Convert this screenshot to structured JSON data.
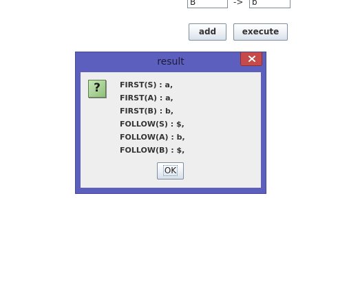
{
  "form": {
    "lhs_value": "B",
    "arrow": "->",
    "rhs_value": "b",
    "add_label": "add",
    "execute_label": "execute"
  },
  "dialog": {
    "title": "result",
    "close_icon": "close-icon",
    "message_icon": "question-icon",
    "message_icon_glyph": "?",
    "lines": [
      "FIRST(S) : a,",
      "FIRST(A) : a,",
      "FIRST(B) : b,",
      "FOLLOW(S) : $,",
      "FOLLOW(A) : b,",
      "FOLLOW(B) : $,"
    ],
    "ok_label": "OK"
  },
  "colors": {
    "dialog_frame": "#5d5fbe",
    "close_button": "#c74a4a",
    "dialog_body": "#eeeeee"
  }
}
